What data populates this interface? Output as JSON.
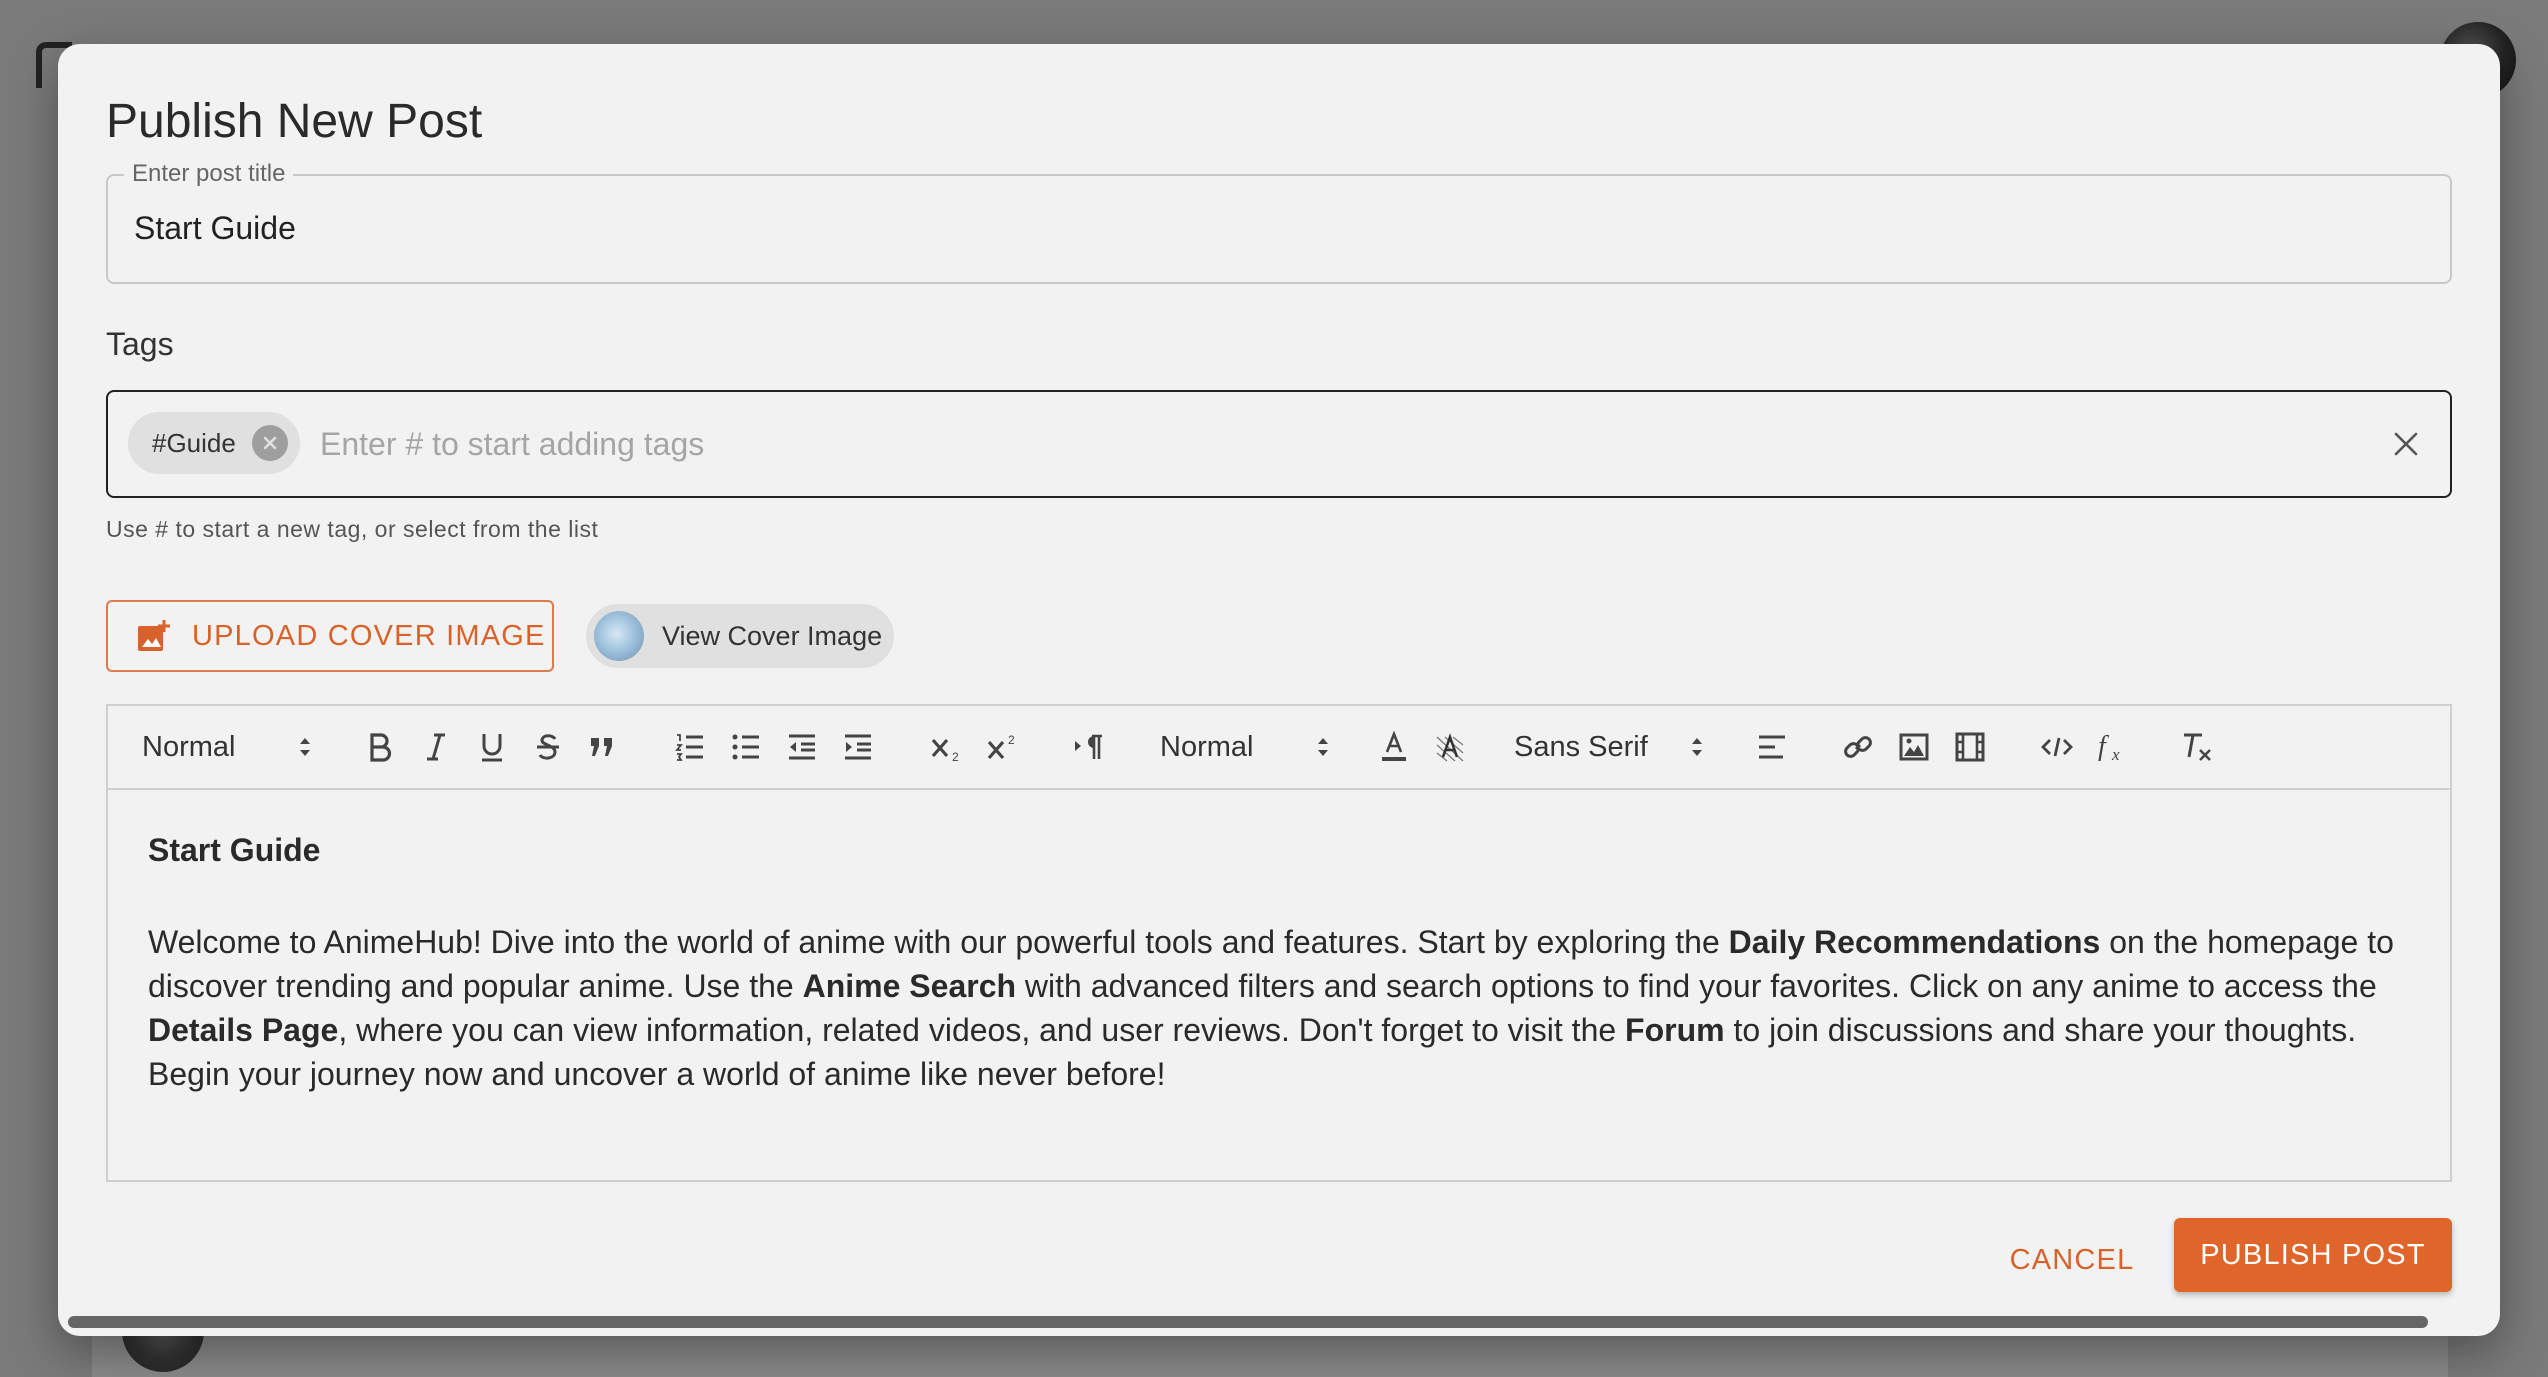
{
  "dialog": {
    "title": "Publish New Post",
    "title_field": {
      "label": "Enter post title",
      "value": "Start Guide"
    },
    "tags": {
      "label": "Tags",
      "chips": [
        "#Guide"
      ],
      "placeholder": "Enter # to start adding tags",
      "helper": "Use # to start a new tag, or select from the list"
    },
    "upload_label": "UPLOAD COVER IMAGE",
    "view_label": "View Cover Image",
    "toolbar": {
      "header_select": "Normal",
      "size_select": "Normal",
      "font_select": "Sans Serif",
      "icons": [
        "bold-icon",
        "italic-icon",
        "underline-icon",
        "strike-icon",
        "blockquote-icon",
        "ordered-list-icon",
        "bullet-list-icon",
        "outdent-icon",
        "indent-icon",
        "subscript-icon",
        "superscript-icon",
        "text-direction-icon",
        "text-color-icon",
        "background-color-icon",
        "align-icon",
        "link-icon",
        "image-icon",
        "video-icon",
        "code-block-icon",
        "formula-icon",
        "clear-format-icon"
      ]
    },
    "content": {
      "heading": "Start Guide",
      "p1": "Welcome to AnimeHub! Dive into the world of anime with our powerful tools and features. Start by exploring the ",
      "b1": "Daily Recommendations",
      "p2": " on the homepage to discover trending and popular anime. Use the ",
      "b2": "Anime Search",
      "p3": " with advanced filters and search options to find your favorites. Click on any anime to access the ",
      "b3": "Details Page",
      "p4": ", where you can view information, related videos, and user reviews. Don't forget to visit the ",
      "b4": "Forum",
      "p5": " to join discussions and share your thoughts. Begin your journey now and uncover a world of anime like never before!"
    },
    "cancel_label": "CANCEL",
    "publish_label": "PUBLISH POST"
  },
  "colors": {
    "accent": "#e0652a",
    "overlay": "#7a7a7a",
    "dialog_bg": "#f2f2f2"
  }
}
